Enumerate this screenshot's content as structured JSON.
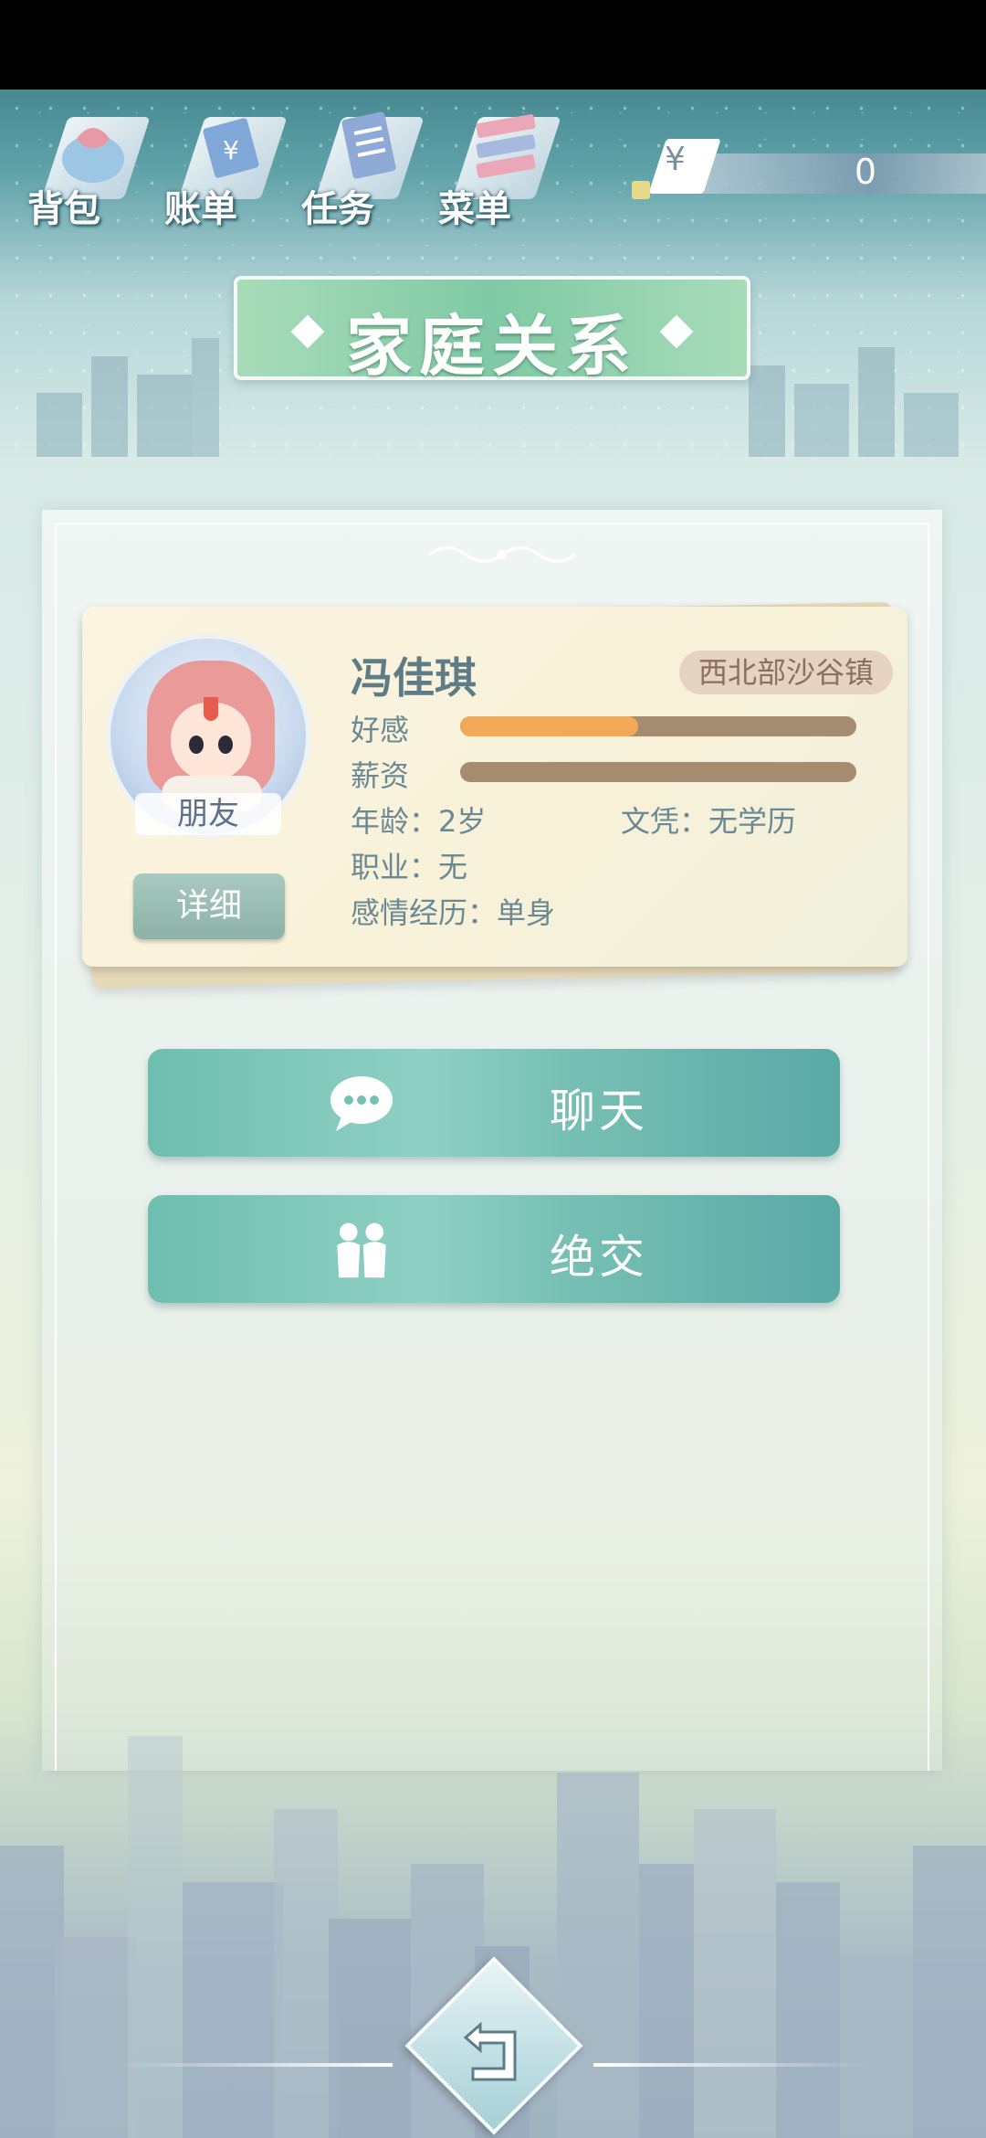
{
  "nav": {
    "items": [
      {
        "label": "背包",
        "icon": "bag-icon"
      },
      {
        "label": "账单",
        "icon": "bill-icon"
      },
      {
        "label": "任务",
        "icon": "task-icon"
      },
      {
        "label": "菜单",
        "icon": "menu-icon"
      }
    ],
    "money_symbol": "¥",
    "money_value": "0"
  },
  "page_title": "家庭关系",
  "character": {
    "name": "冯佳琪",
    "location": "西北部沙谷镇",
    "relation": "朋友",
    "detail_button": "详细",
    "affection_label": "好感",
    "affection_level": 0.45,
    "salary_label": "薪资",
    "salary_level": 0.0,
    "age_text": "年龄：2岁",
    "education_text": "文凭：无学历",
    "job_text": "职业：无",
    "love_history_text": "感情经历：单身"
  },
  "actions": {
    "chat": {
      "label": "聊天",
      "icon": "chat-bubble-icon"
    },
    "break_off": {
      "label": "绝交",
      "icon": "two-people-icon"
    }
  },
  "back_button": {
    "icon": "back-arrow-icon"
  },
  "colors": {
    "accent_green": "#7fc9a6",
    "teal_button": "#6fbeb0",
    "affection_fill": "#f2aa58",
    "bar_track": "#a58c70",
    "location_badge": "#e6d2c0"
  }
}
